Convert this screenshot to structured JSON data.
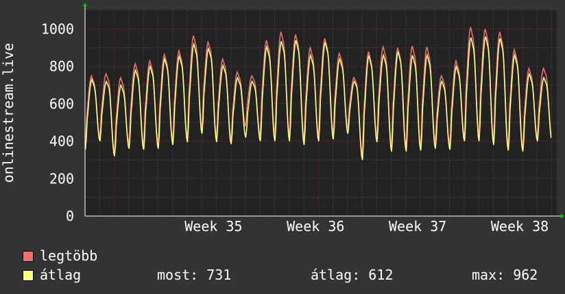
{
  "chart_data": {
    "type": "line",
    "ylabel": "onlinestream.live",
    "ylim": [
      0,
      1100
    ],
    "y_ticks": [
      "0",
      "200",
      "400",
      "600",
      "800",
      "1000"
    ],
    "x_ticks": [
      "Week 35",
      "Week 36",
      "Week 37",
      "Week 38"
    ],
    "grid": true,
    "colors": {
      "legtobb": "#f07070",
      "atlag": "#ffff80",
      "background": "#222222",
      "grid_major": "#7a3030",
      "grid_minor": "#555555",
      "axis": "#ffffff"
    },
    "series": [
      {
        "name": "legtöbb",
        "color": "#f07070"
      },
      {
        "name": "átlag",
        "color": "#ffff80"
      }
    ],
    "daily": [
      {
        "peak_max": 750,
        "peak_avg": 730,
        "trough_max": 380,
        "trough_avg": 355
      },
      {
        "peak_max": 760,
        "peak_avg": 720,
        "trough_max": 420,
        "trough_avg": 400
      },
      {
        "peak_max": 740,
        "peak_avg": 700,
        "trough_max": 340,
        "trough_avg": 320
      },
      {
        "peak_max": 815,
        "peak_avg": 780,
        "trough_max": 385,
        "trough_avg": 360
      },
      {
        "peak_max": 830,
        "peak_avg": 800,
        "trough_max": 380,
        "trough_avg": 355
      },
      {
        "peak_max": 865,
        "peak_avg": 840,
        "trough_max": 385,
        "trough_avg": 360
      },
      {
        "peak_max": 885,
        "peak_avg": 855,
        "trough_max": 400,
        "trough_avg": 380
      },
      {
        "peak_max": 965,
        "peak_avg": 920,
        "trough_max": 420,
        "trough_avg": 395
      },
      {
        "peak_max": 930,
        "peak_avg": 895,
        "trough_max": 470,
        "trough_avg": 440
      },
      {
        "peak_max": 840,
        "peak_avg": 805,
        "trough_max": 420,
        "trough_avg": 395
      },
      {
        "peak_max": 770,
        "peak_avg": 740,
        "trough_max": 410,
        "trough_avg": 385
      },
      {
        "peak_max": 750,
        "peak_avg": 720,
        "trough_max": 480,
        "trough_avg": 420
      },
      {
        "peak_max": 940,
        "peak_avg": 905,
        "trough_max": 430,
        "trough_avg": 400
      },
      {
        "peak_max": 985,
        "peak_avg": 935,
        "trough_max": 430,
        "trough_avg": 400
      },
      {
        "peak_max": 970,
        "peak_avg": 940,
        "trough_max": 430,
        "trough_avg": 400
      },
      {
        "peak_max": 900,
        "peak_avg": 860,
        "trough_max": 405,
        "trough_avg": 380
      },
      {
        "peak_max": 950,
        "peak_avg": 930,
        "trough_max": 430,
        "trough_avg": 400
      },
      {
        "peak_max": 870,
        "peak_avg": 840,
        "trough_max": 440,
        "trough_avg": 410
      },
      {
        "peak_max": 740,
        "peak_avg": 720,
        "trough_max": 470,
        "trough_avg": 440
      },
      {
        "peak_max": 880,
        "peak_avg": 860,
        "trough_max": 330,
        "trough_avg": 300
      },
      {
        "peak_max": 905,
        "peak_avg": 860,
        "trough_max": 420,
        "trough_avg": 395
      },
      {
        "peak_max": 900,
        "peak_avg": 880,
        "trough_max": 370,
        "trough_avg": 345
      },
      {
        "peak_max": 910,
        "peak_avg": 860,
        "trough_max": 365,
        "trough_avg": 345
      },
      {
        "peak_max": 905,
        "peak_avg": 860,
        "trough_max": 360,
        "trough_avg": 350
      },
      {
        "peak_max": 750,
        "peak_avg": 720,
        "trough_max": 390,
        "trough_avg": 360
      },
      {
        "peak_max": 830,
        "peak_avg": 800,
        "trough_max": 380,
        "trough_avg": 355
      },
      {
        "peak_max": 1010,
        "peak_avg": 955,
        "trough_max": 420,
        "trough_avg": 400
      },
      {
        "peak_max": 1000,
        "peak_avg": 960,
        "trough_max": 430,
        "trough_avg": 400
      },
      {
        "peak_max": 985,
        "peak_avg": 950,
        "trough_max": 400,
        "trough_avg": 380
      },
      {
        "peak_max": 890,
        "peak_avg": 860,
        "trough_max": 370,
        "trough_avg": 350
      },
      {
        "peak_max": 790,
        "peak_avg": 760,
        "trough_max": 360,
        "trough_avg": 345
      },
      {
        "peak_max": 790,
        "peak_avg": 740,
        "trough_max": 420,
        "trough_avg": 400
      }
    ],
    "start_day_offset": 0.0,
    "end_value": {
      "legtobb": 780,
      "atlag": 731
    }
  },
  "legend": {
    "item1": "legtöbb",
    "item2": "átlag"
  },
  "stats": {
    "most": "most: 731",
    "atlag": "átlag: 612",
    "max": "max: 962"
  }
}
